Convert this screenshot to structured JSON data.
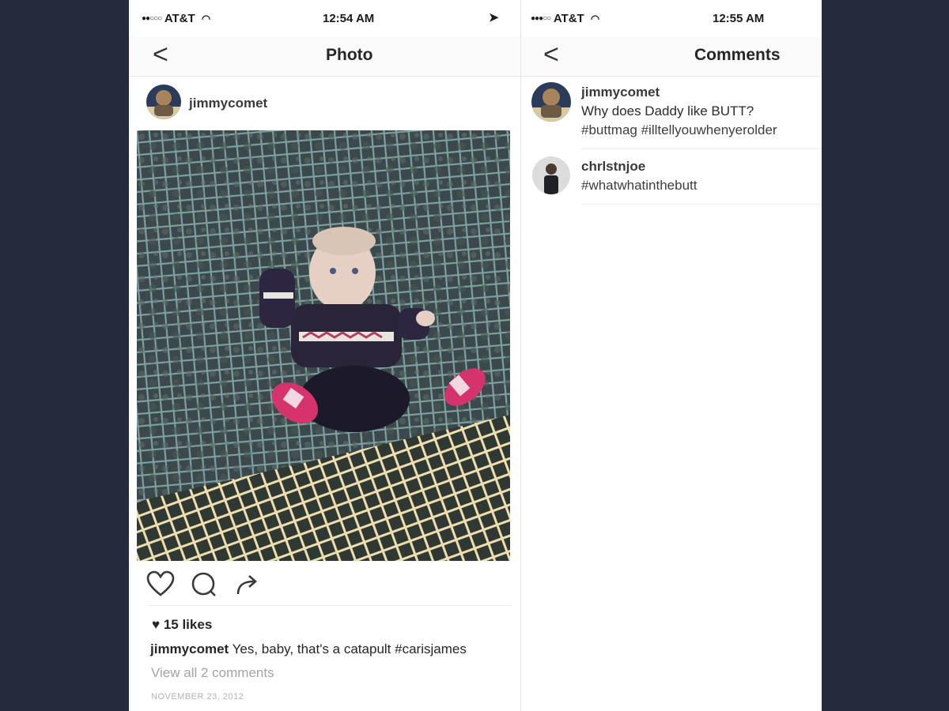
{
  "left_screen": {
    "status": {
      "carrier": "AT&T",
      "time": "12:54 AM"
    },
    "nav": {
      "back": "<",
      "title": "Photo"
    },
    "post": {
      "username": "jimmycomet",
      "likes": "15 likes",
      "caption_user": "jimmycomet",
      "caption_text": "Yes, baby, that's a catapult #carisjames",
      "view_comments": "View all 2 comments",
      "date": "NOVEMBER 23, 2012"
    },
    "actions": [
      "heart-icon",
      "comment-icon",
      "share-icon"
    ]
  },
  "right_screen": {
    "status": {
      "carrier": "AT&T",
      "time": "12:55 AM"
    },
    "nav": {
      "back": "<",
      "title": "Comments"
    },
    "comments": [
      {
        "username": "jimmycomet",
        "line1": "Why does Daddy like BUTT?",
        "line2": "#buttmag #illtellyouwhenyerolder"
      },
      {
        "username": "chrlstnjoe",
        "line1": "#whatwhatinthebutt",
        "line2": ""
      }
    ]
  },
  "colors": {
    "background": "#222c3a",
    "screen": "#ffffff",
    "text": "#262626",
    "muted": "#a3a3a3"
  }
}
